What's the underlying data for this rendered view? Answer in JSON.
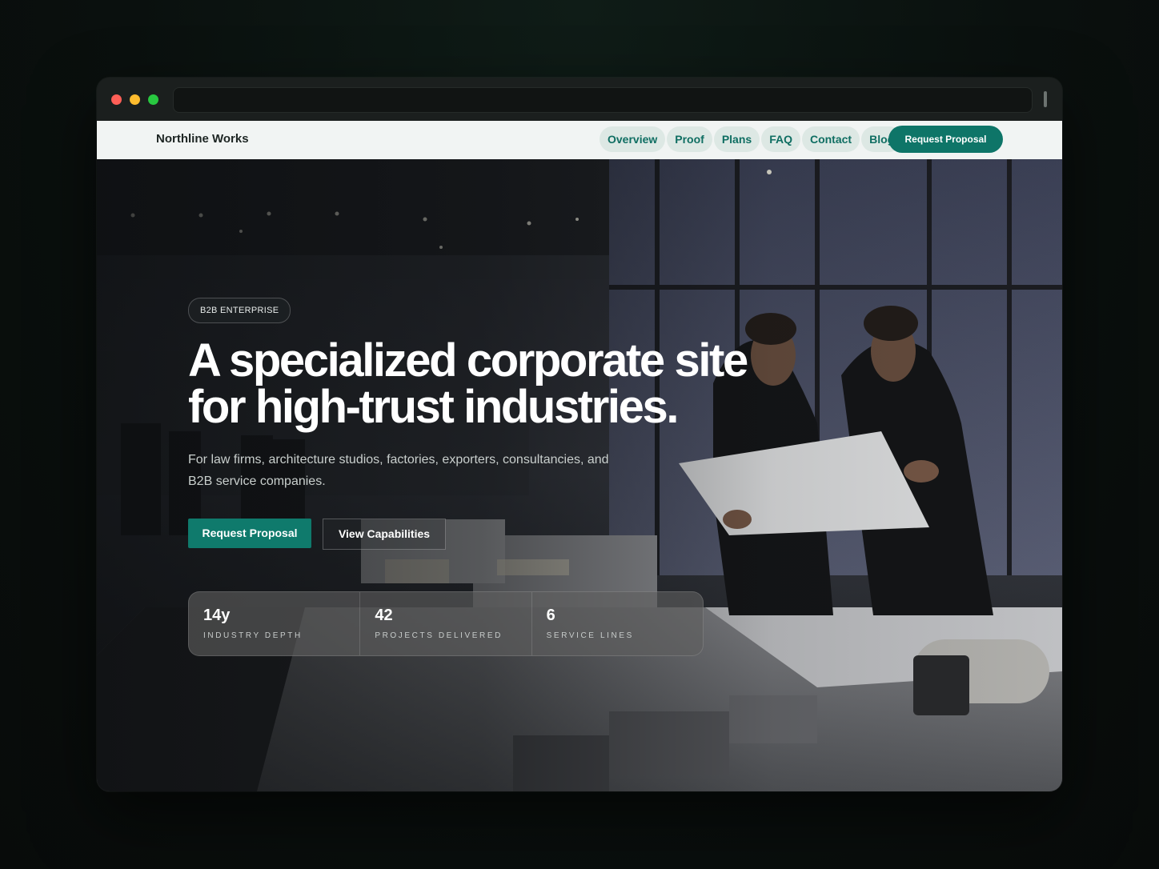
{
  "browser": {
    "url": ""
  },
  "nav": {
    "brand": "Northline Works",
    "links": [
      "Overview",
      "Proof",
      "Plans",
      "FAQ",
      "Contact",
      "Blog"
    ],
    "cta": "Request Proposal"
  },
  "hero": {
    "badge": "B2B ENTERPRISE",
    "headline": "A specialized corporate site for high-trust industries.",
    "subheadline": "For law firms, architecture studios, factories, exporters, consultancies, and B2B service companies.",
    "primary_button": "Request Proposal",
    "secondary_button": "View Capabilities",
    "stats": [
      {
        "value": "14y",
        "label": "INDUSTRY DEPTH"
      },
      {
        "value": "42",
        "label": "PROJECTS DELIVERED"
      },
      {
        "value": "6",
        "label": "SERVICE LINES"
      }
    ]
  },
  "colors": {
    "accent": "#0f7a6c",
    "nav_link_bg": "#dde8e4",
    "nav_link_text": "#0f6e62"
  }
}
